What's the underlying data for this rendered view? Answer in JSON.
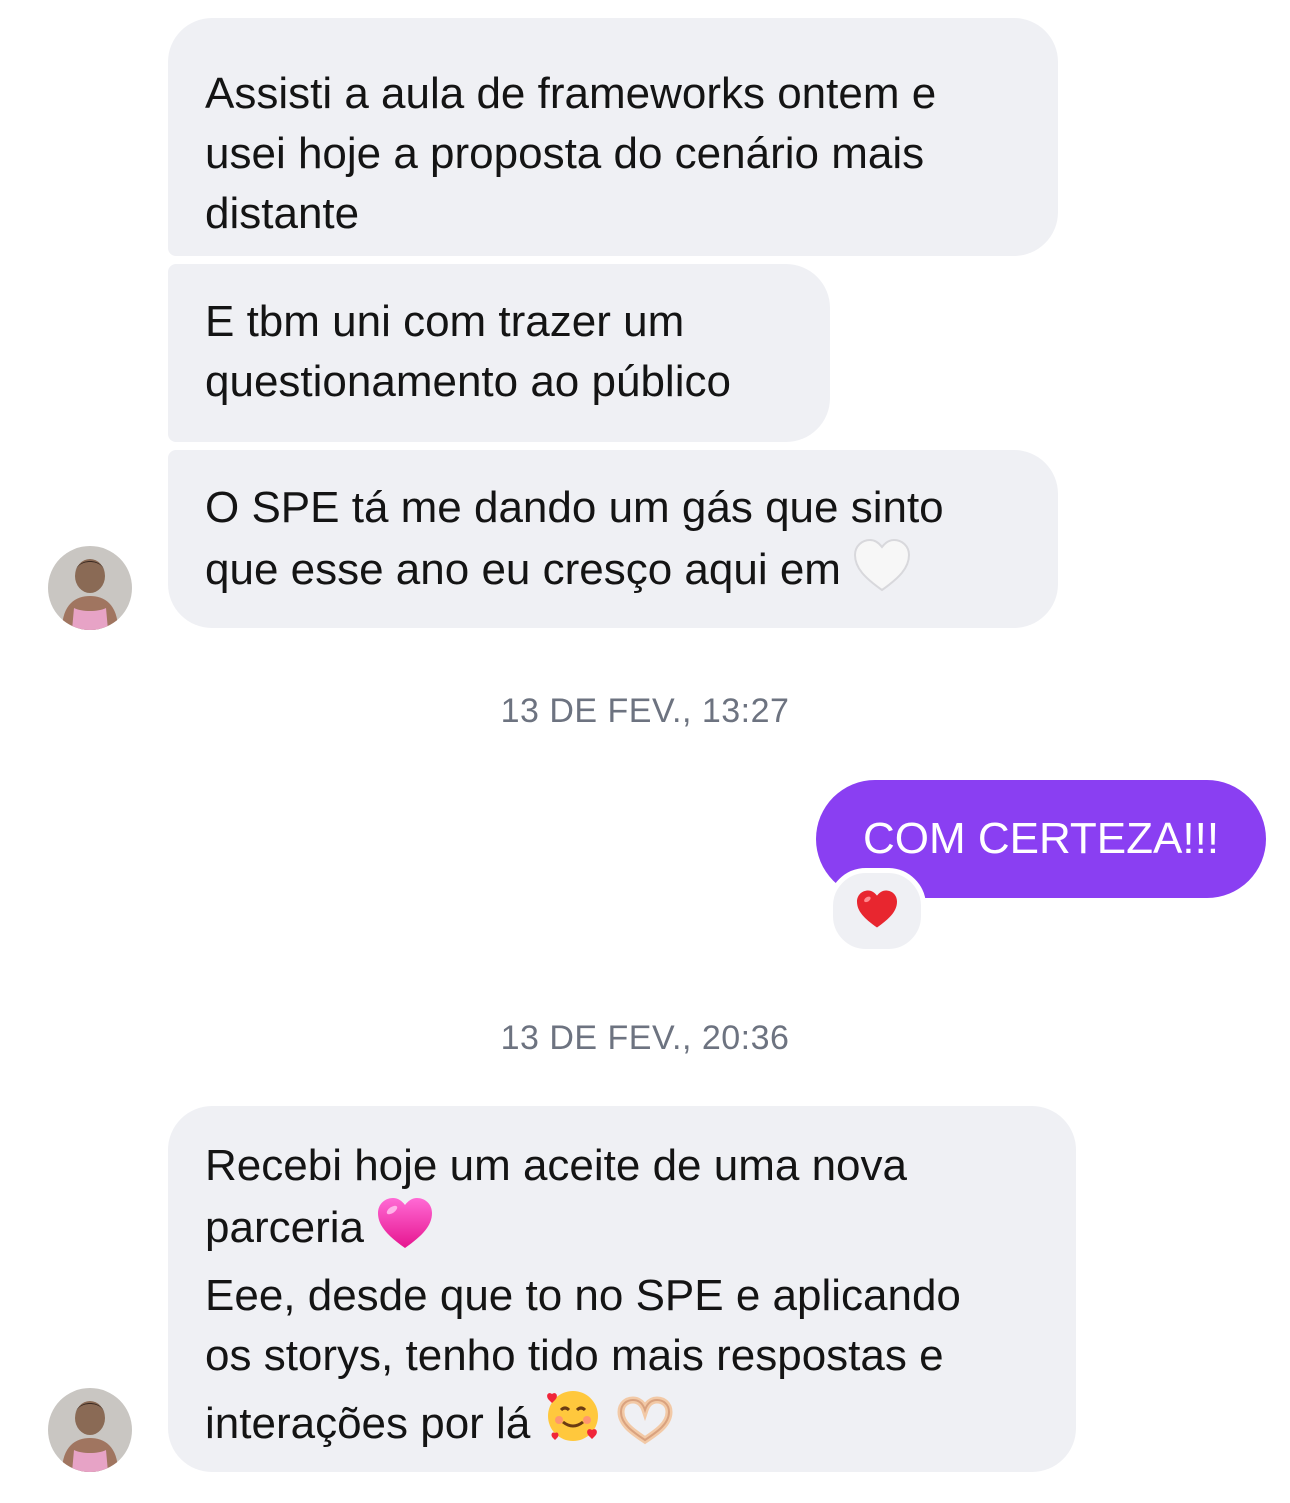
{
  "thread": {
    "messages_block_1": [
      {
        "lines": [
          "Assisti a aula de frameworks ontem e",
          "usei hoje a proposta do cenário mais",
          "distante"
        ]
      },
      {
        "lines": [
          "E tbm uni com trazer um",
          "questionamento ao público"
        ]
      },
      {
        "lines": [
          "O SPE tá me dando um gás que sinto",
          "que esse ano eu cresço aqui em"
        ],
        "trailing_emoji": "white-heart"
      }
    ],
    "timestamp_1": "13 DE FEV., 13:27",
    "outgoing_message": {
      "text": "COM CERTEZA!!!",
      "reaction": "red-heart"
    },
    "timestamp_2": "13 DE FEV., 20:36",
    "messages_block_2": [
      {
        "lines": [
          "Recebi hoje um aceite de uma nova",
          "parceria",
          "Eee, desde que to no SPE e aplicando",
          "os storys, tenho tido mais respostas e",
          "interações por lá"
        ],
        "emojis": [
          "pink-heart",
          "smiling-face-with-hearts",
          "heart-hands"
        ]
      }
    ]
  },
  "colors": {
    "incoming_bubble": "#eff0f4",
    "outgoing_bubble": "#8a3ff2",
    "timestamp_text": "#6d7380"
  }
}
